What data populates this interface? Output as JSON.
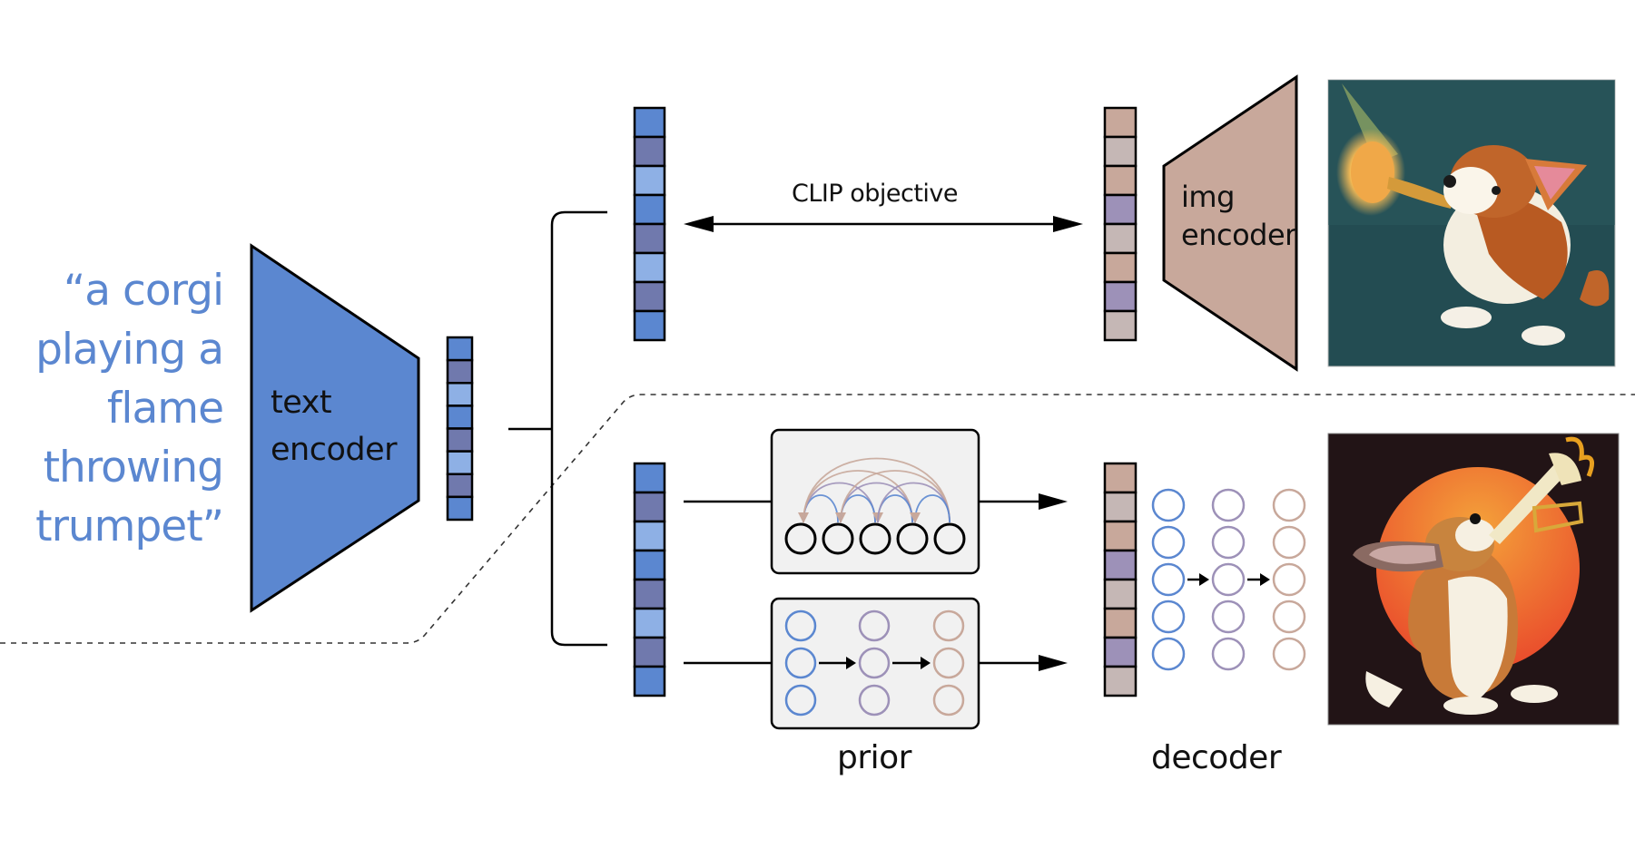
{
  "caption": {
    "lines": [
      "“a corgi",
      "playing a",
      "flame",
      "throwing",
      "trumpet”"
    ],
    "color": "#5B87D0"
  },
  "text_encoder": {
    "line1": "text",
    "line2": "encoder",
    "fill": "#5B87D0"
  },
  "img_encoder": {
    "line1": "img",
    "line2": "encoder",
    "fill": "#C8A89B"
  },
  "clip_objective_label": "CLIP objective",
  "prior_label": "prior",
  "decoder_label": "decoder",
  "text_embedding_colors": [
    "#5B87D0",
    "#7079AD",
    "#8EB0E5",
    "#5B87D0",
    "#7079AD",
    "#8EB0E5",
    "#7079AD",
    "#5B87D0"
  ],
  "image_embedding_colors": [
    "#C8A89B",
    "#C5B7B5",
    "#C8A89B",
    "#9D91B8",
    "#C5B7B5",
    "#C8A89B",
    "#9D91B8",
    "#C5B7B5"
  ],
  "network_layer_colors": [
    "#5B87D0",
    "#9D91B8",
    "#C8A89B"
  ],
  "prior_autoregressive_tokens": 5,
  "prior_diffusion_layers": {
    "columns": 3,
    "rows": 3
  },
  "decoder_layers": {
    "columns": 3,
    "rows": 5
  },
  "images": {
    "top": {
      "description": "corgi playing a glowing trumpet on a teal background",
      "background": "#234C52"
    },
    "bottom": {
      "description": "corgi playing a flame-throwing trumpet in front of an orange sun on a dark background",
      "background": "#221416",
      "accent": "#E8542A"
    }
  },
  "panel_fill": "#F1F1F1"
}
